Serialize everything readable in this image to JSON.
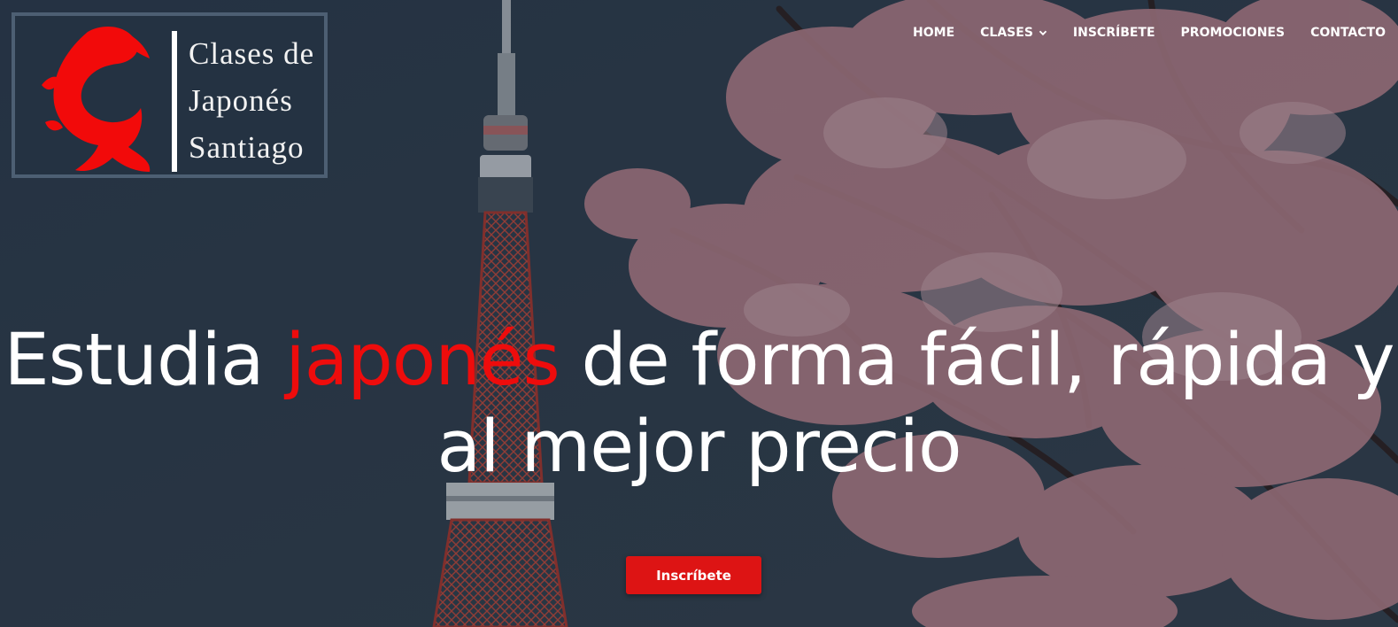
{
  "brand": {
    "line1": "Clases de",
    "line2": "Japonés",
    "line3": "Santiago",
    "koi_color": "#f20a0a"
  },
  "nav": {
    "items": [
      {
        "label": "HOME"
      },
      {
        "label": "CLASES",
        "has_dropdown": true
      },
      {
        "label": "INSCRÍBETE"
      },
      {
        "label": "PROMOCIONES"
      },
      {
        "label": "CONTACTO"
      }
    ]
  },
  "hero": {
    "headline_before": "Estudia ",
    "headline_accent": "japonés",
    "headline_after": " de forma fácil, rápida y al mejor precio",
    "cta_label": "Inscríbete"
  },
  "colors": {
    "accent": "#ee0c0c",
    "button": "#dd1414",
    "background": "#2a3645",
    "blossom": "#c98a95",
    "tower_red": "#c0392b"
  }
}
